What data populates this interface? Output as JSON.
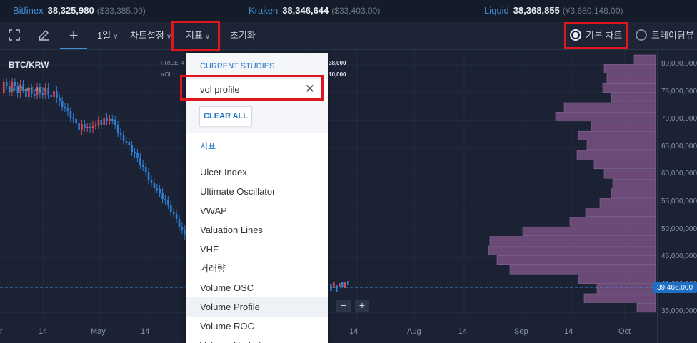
{
  "ticker": [
    {
      "exchange": "Bitfinex",
      "price": "38,325,980",
      "alt": "($33,385.00)"
    },
    {
      "exchange": "Kraken",
      "price": "38,346,644",
      "alt": "($33,403.00)"
    },
    {
      "exchange": "Liquid",
      "price": "38,368,855",
      "alt": "(¥3,680,148.00)"
    }
  ],
  "toolbar": {
    "fullscreen_icon": "fullscreen-icon",
    "draw_icon": "pencil-icon",
    "crosshair_icon": "crosshair-icon",
    "interval": "1일",
    "chart_settings": "차트설정",
    "indicators": "지표",
    "reset": "초기화",
    "basic_chart": "기본 차트",
    "tradingview": "트레이딩뷰"
  },
  "chart": {
    "symbol": "BTC/KRW",
    "price_label": "PRICE:",
    "price_value": "4",
    "vol_label": "VOL:",
    "overlays": "Overlays",
    "hidden_price": "38,000",
    "hidden_vol": "10,000",
    "current_price": "39,466,000",
    "y_ticks": [
      "80,000,000",
      "75,000,000",
      "70,000,000",
      "65,000,000",
      "60,000,000",
      "55,000,000",
      "50,000,000",
      "45,000,000",
      "40,000,000",
      "35,000,000"
    ],
    "x_ticks": [
      "r",
      "14",
      "May",
      "14",
      "14",
      "Aug",
      "14",
      "Sep",
      "14",
      "Oct"
    ],
    "zoom_out": "−",
    "zoom_in": "+"
  },
  "dropdown": {
    "current_studies": "CURRENT STUDIES",
    "search_value": "vol profile",
    "clear_icon": "close-icon",
    "clear_all": "CLEAR ALL",
    "section": "지표",
    "items": [
      "Ulcer Index",
      "Ultimate Oscillator",
      "VWAP",
      "Valuation Lines",
      "VHF",
      "거래량",
      "Volume OSC",
      "Volume Profile",
      "Volume ROC",
      "Volume Underlay"
    ],
    "highlighted": "Volume Profile"
  },
  "colors": {
    "accent": "#3f8fd8",
    "up_candle": "#d9484e",
    "down_candle": "#2f7fd6",
    "volume_profile": "#6b4a78",
    "highlight_box": "#e0161e"
  }
}
